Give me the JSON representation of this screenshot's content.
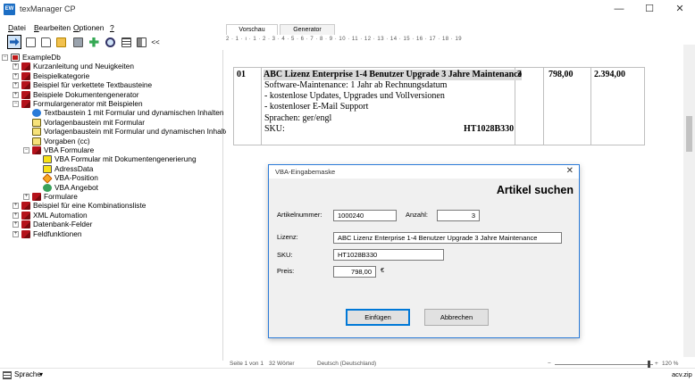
{
  "window": {
    "icon_label": "EW",
    "title": "texManager CP",
    "minimize": "—",
    "maximize": "☐",
    "close": "✕"
  },
  "menu": [
    {
      "label_u": "D",
      "label_rest": "atei"
    },
    {
      "label_u": "B",
      "label_rest": "earbeiten"
    },
    {
      "label_u": "O",
      "label_rest": "ptionen"
    },
    {
      "label_u": "?",
      "label_rest": ""
    }
  ],
  "toolbar": {
    "collapse_label": "<<",
    "icons": [
      "export-icon",
      "document-icon",
      "new-document-icon",
      "open-folder-icon",
      "print-icon",
      "add-icon",
      "search-icon",
      "list-view-icon",
      "grid-view-icon"
    ]
  },
  "tree": [
    {
      "label": "ExampleDb",
      "exp": "−",
      "icon": "ico-db"
    },
    {
      "label": "Kurzanleitung und Neuigkeiten",
      "exp": "+",
      "icon": "ico-book"
    },
    {
      "label": "Beispielkategorie",
      "exp": "+",
      "icon": "ico-book"
    },
    {
      "label": "Beispiel für verkettete Textbausteine",
      "exp": "+",
      "icon": "ico-book"
    },
    {
      "label": "Beispiele Dokumentengenerator",
      "exp": "+",
      "icon": "ico-book"
    },
    {
      "label": "Formulargenerator mit Beispielen",
      "exp": "−",
      "icon": "ico-book"
    },
    {
      "label": "Textbaustein 1 mit Formular und dynamischen Inhalten",
      "exp": "",
      "icon": "ico-puzzle"
    },
    {
      "label": "Vorlagenbaustein mit Formular",
      "exp": "",
      "icon": "ico-form"
    },
    {
      "label": "Vorlagenbaustein mit Formular und dynamischen Inhalten",
      "exp": "",
      "icon": "ico-form"
    },
    {
      "label": "Vorgaben (cc)",
      "exp": "",
      "icon": "ico-form"
    },
    {
      "label": "VBA Formulare",
      "exp": "−",
      "icon": "ico-book"
    },
    {
      "label": "VBA Formular mit Dokumentengenerierung",
      "exp": "",
      "icon": "ico-yellow"
    },
    {
      "label": "AdressData",
      "exp": "",
      "icon": "ico-yellow"
    },
    {
      "label": "VBA-Position",
      "exp": "",
      "icon": "ico-diamond"
    },
    {
      "label": "VBA Angebot",
      "exp": "",
      "icon": "ico-green"
    },
    {
      "label": "Formulare",
      "exp": "+",
      "icon": "ico-book"
    },
    {
      "label": "Beispiel für eine Kombinationsliste",
      "exp": "+",
      "icon": "ico-book"
    },
    {
      "label": "XML Automation",
      "exp": "+",
      "icon": "ico-book"
    },
    {
      "label": "Datenbank-Felder",
      "exp": "+",
      "icon": "ico-book"
    },
    {
      "label": "Feldfunktionen",
      "exp": "+",
      "icon": "ico-book"
    }
  ],
  "tabs": {
    "preview": "Vorschau",
    "generator": "Generator"
  },
  "ruler": "2 · 1 · ı · 1 · 2 · 3 · 4 · 5 · 6 · 7 · 8 · 9 · 10 · 11 · 12 · 13 · 14 · 15 · 16 · 17 · 18 · 19",
  "document": {
    "pos": "01",
    "title": "ABC Lizenz Enterprise 1-4 Benutzer Upgrade 3 Jahre Maintenance",
    "line1": "Software-Maintenance: 1 Jahr ab Rechnungsdatum",
    "line2": "- kostenlose Updates, Upgrades und Vollversionen",
    "line3": "- kostenloser E-Mail Support",
    "line4": "Sprachen: ger/engl",
    "sku_label": "SKU:",
    "sku_value": "HT1028B330",
    "qty": "3",
    "price": "798,00",
    "total": "2.394,00"
  },
  "status": {
    "page": "Seite 1 von 1",
    "words": "32 Wörter",
    "language": "Deutsch (Deutschland)",
    "zoom_minus": "−",
    "zoom_plus": "+",
    "zoom": "120 %",
    "file": "acv.zip"
  },
  "bottom": {
    "language_label": "Sprache",
    "dropdown": "▾"
  },
  "dialog": {
    "title": "VBA-Eingabemaske",
    "close": "✕",
    "heading": "Artikel suchen",
    "artikel_label": "Artikelnummer:",
    "artikel_value": "1000240",
    "anzahl_label": "Anzahl:",
    "anzahl_value": "3",
    "lizenz_label": "Lizenz:",
    "lizenz_value": "ABC Lizenz Enterprise 1-4 Benutzer Upgrade 3 Jahre Maintenance",
    "sku_label": "SKU:",
    "sku_value": "HT1028B330",
    "preis_label": "Preis:",
    "preis_value": "798,00",
    "currency": "€",
    "insert_button": "Einfügen",
    "cancel_button": "Abbrechen"
  }
}
